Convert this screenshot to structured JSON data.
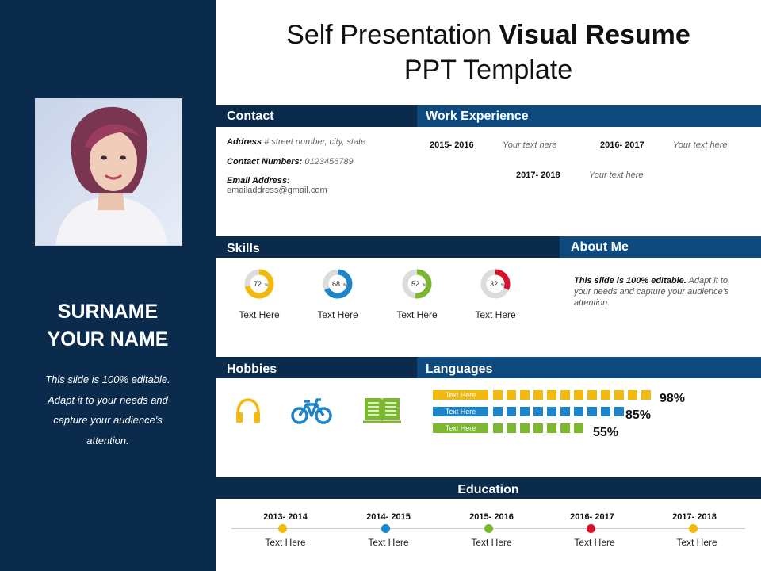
{
  "title": {
    "part1": "Self Presentation ",
    "part2": "Visual Resume",
    "line2": "PPT Template"
  },
  "sidebar": {
    "surname": "SURNAME",
    "your_name": "YOUR NAME",
    "text": "This slide is 100% editable. Adapt it to your needs and capture your audience's attention."
  },
  "contact": {
    "header": "Contact",
    "address_label": "Address",
    "address_value": "# street number, city, state",
    "numbers_label": "Contact Numbers:",
    "numbers_value": "0123456789",
    "email_label": "Email Address:",
    "email_value": "emailaddress@gmail.com"
  },
  "work": {
    "header": "Work Experience",
    "items": [
      {
        "years": "2015- 2016",
        "text": "Your text here"
      },
      {
        "years": "2016- 2017",
        "text": "Your text here"
      },
      {
        "years": "2017- 2018",
        "text": "Your text here"
      }
    ]
  },
  "skills": {
    "header": "Skills",
    "items": [
      {
        "value": 72,
        "label": "72",
        "unit": "%",
        "color": "#f2b90f",
        "text": "Text Here"
      },
      {
        "value": 68,
        "label": "68",
        "unit": "%",
        "color": "#1e86c8",
        "text": "Text Here"
      },
      {
        "value": 52,
        "label": "52",
        "unit": "%",
        "color": "#7cb82f",
        "text": "Text Here"
      },
      {
        "value": 32,
        "label": "32",
        "unit": "%",
        "color": "#d9122b",
        "text": "Text Here"
      }
    ]
  },
  "about": {
    "header": "About Me",
    "bold": "This slide is 100% editable.",
    "text": " Adapt it to your needs and capture your audience's attention."
  },
  "hobbies": {
    "header": "Hobbies",
    "icons": [
      "headphones-icon",
      "bicycle-icon",
      "book-icon"
    ]
  },
  "languages": {
    "header": "Languages",
    "items": [
      {
        "tag": "Text Here",
        "percent": "98%",
        "value": 98,
        "color": "#f2b90f"
      },
      {
        "tag": "Text Here",
        "percent": "85%",
        "value": 85,
        "color": "#1e86c8"
      },
      {
        "tag": "Text Here",
        "percent": "55%",
        "value": 55,
        "color": "#7cb82f"
      }
    ]
  },
  "education": {
    "header": "Education",
    "items": [
      {
        "years": "2013- 2014",
        "text": "Text Here",
        "color": "#f2b90f"
      },
      {
        "years": "2014- 2015",
        "text": "Text Here",
        "color": "#1e86c8"
      },
      {
        "years": "2015- 2016",
        "text": "Text Here",
        "color": "#7cb82f"
      },
      {
        "years": "2016- 2017",
        "text": "Text Here",
        "color": "#d9122b"
      },
      {
        "years": "2017- 2018",
        "text": "Text Here",
        "color": "#f2b90f"
      }
    ]
  },
  "colors": {
    "navy": "#0b2b4c",
    "blue": "#0e4a7e",
    "yellow": "#f2b90f",
    "sky": "#1e86c8",
    "green": "#7cb82f",
    "red": "#d9122b"
  }
}
